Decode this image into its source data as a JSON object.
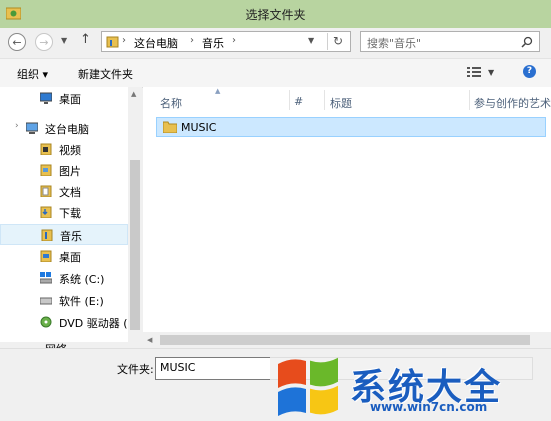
{
  "window": {
    "title": "选择文件夹"
  },
  "address": {
    "segments": [
      "这台电脑",
      "音乐"
    ],
    "search_placeholder": "搜索\"音乐\""
  },
  "toolbar": {
    "organize": "组织 ▾",
    "new_folder": "新建文件夹"
  },
  "nav": {
    "items": [
      {
        "label": "桌面",
        "icon": "desktop-icon"
      },
      {
        "label": "这台电脑",
        "icon": "computer-icon"
      },
      {
        "label": "视频",
        "icon": "folder-video-icon"
      },
      {
        "label": "图片",
        "icon": "folder-pictures-icon"
      },
      {
        "label": "文档",
        "icon": "folder-documents-icon"
      },
      {
        "label": "下载",
        "icon": "folder-downloads-icon"
      },
      {
        "label": "音乐",
        "icon": "folder-music-icon",
        "selected": true
      },
      {
        "label": "桌面",
        "icon": "desktop-icon"
      },
      {
        "label": "系统 (C:)",
        "icon": "drive-c-icon"
      },
      {
        "label": "软件 (E:)",
        "icon": "drive-e-icon"
      },
      {
        "label": "DVD 驱动器 (",
        "icon": "dvd-drive-icon"
      },
      {
        "label": "网络",
        "icon": "network-icon"
      }
    ]
  },
  "columns": [
    "名称",
    "#",
    "标题",
    "参与创作的艺术"
  ],
  "files": [
    {
      "name": "MUSIC",
      "selected": true
    }
  ],
  "bottom": {
    "folder_label": "文件夹:",
    "folder_value": "MUSIC"
  },
  "watermark": {
    "text": "系统大全",
    "url": "www.win7cn.com"
  },
  "colors": {
    "titlebar": "#b8d4a0",
    "selection": "#cce8ff",
    "watermark": "#1a5dbf"
  }
}
